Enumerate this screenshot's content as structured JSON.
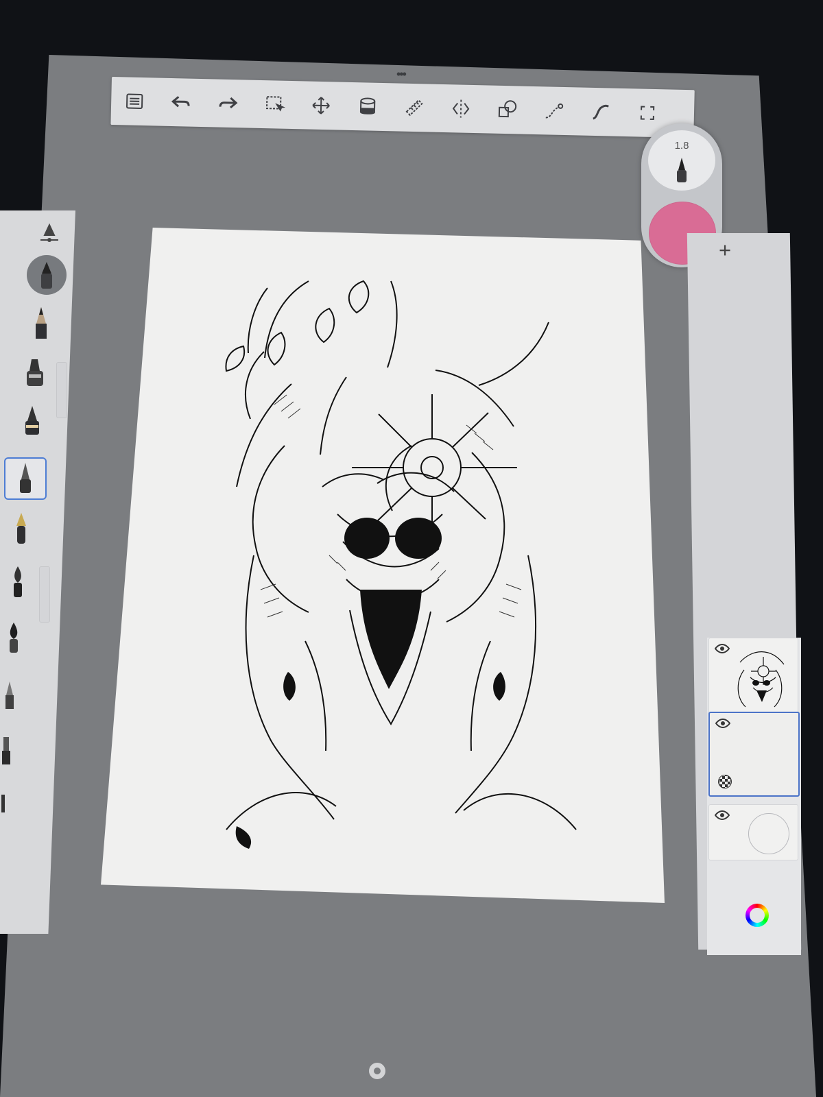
{
  "app": {
    "name_icon": "sketchbook-style drawing app",
    "accent_color": "#4d7dd4"
  },
  "toolbar": {
    "items": [
      {
        "icon": "list-icon"
      },
      {
        "icon": "undo-icon"
      },
      {
        "icon": "redo-icon"
      },
      {
        "icon": "selection-icon"
      },
      {
        "icon": "move-icon"
      },
      {
        "icon": "fill-icon"
      },
      {
        "icon": "ruler-icon"
      },
      {
        "icon": "symmetry-icon"
      },
      {
        "icon": "shape-icon"
      },
      {
        "icon": "stroke-icon"
      },
      {
        "icon": "curve-icon"
      },
      {
        "icon": "fullscreen-icon"
      }
    ]
  },
  "brush_controls": {
    "size": "1.8",
    "color": "#d96c95"
  },
  "layers": {
    "add_icon": "+",
    "items": [
      {
        "name": "drawing-layer",
        "visible": true
      },
      {
        "name": "active-empty-layer",
        "visible": true
      },
      {
        "name": "background-layer",
        "visible": true
      }
    ]
  }
}
